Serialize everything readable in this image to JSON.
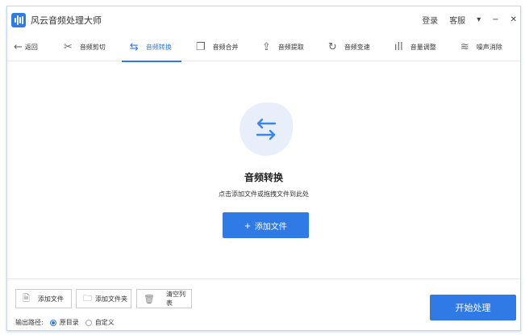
{
  "app": {
    "title": "风云音频处理大师",
    "login": "登录",
    "service": "客服",
    "menu_icon": "▾",
    "minimize": "−",
    "close": "✕"
  },
  "nav": {
    "back": "返回",
    "tabs": [
      {
        "label": "音频剪切",
        "icon": "scissors-icon",
        "glyph": "✂"
      },
      {
        "label": "音频转换",
        "icon": "convert-icon",
        "glyph": "⇆"
      },
      {
        "label": "音频合并",
        "icon": "merge-icon",
        "glyph": "❐"
      },
      {
        "label": "音频提取",
        "icon": "extract-icon",
        "glyph": "⇪"
      },
      {
        "label": "音频变速",
        "icon": "speed-icon",
        "glyph": "↻"
      },
      {
        "label": "音量调整",
        "icon": "volume-icon",
        "glyph": "ıll"
      },
      {
        "label": "噪声消除",
        "icon": "noise-icon",
        "glyph": "≋"
      }
    ],
    "active": 1
  },
  "main": {
    "heading": "音频转换",
    "hint": "点击添加文件或拖拽文件到此处",
    "add_button": "添加文件",
    "add_glyph": "+"
  },
  "bottom": {
    "add_file": "添加文件",
    "add_folder": "添加文件夹",
    "clear_list": "清空列表",
    "start": "开始处理",
    "output_label": "输出路径:",
    "options": [
      "原目录",
      "自定义"
    ],
    "selected": 0
  },
  "colors": {
    "accent": "#2f7ae5"
  }
}
